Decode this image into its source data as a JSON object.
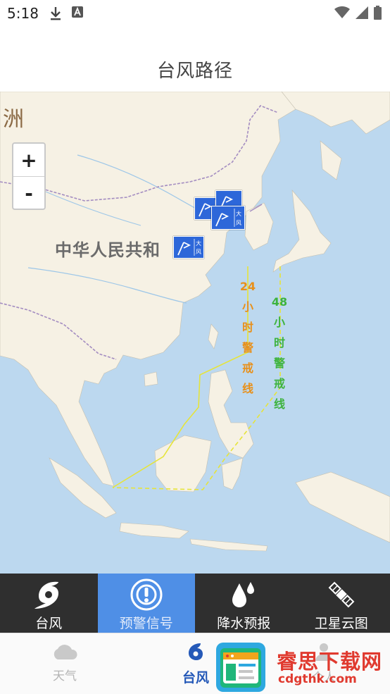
{
  "status_bar": {
    "time": "5:18",
    "icons": [
      "download-icon",
      "a-notification-icon",
      "wifi-icon",
      "signal-icon",
      "battery-icon"
    ]
  },
  "header": {
    "title": "台风路径"
  },
  "map": {
    "labels": {
      "continent_fragment": "洲",
      "country": "中华人民共和"
    },
    "zoom": {
      "in_label": "+",
      "out_label": "-"
    },
    "warning_lines": [
      {
        "text": "24小时警戒线",
        "chars": [
          "24",
          "小",
          "时",
          "警",
          "戒",
          "线"
        ],
        "color": "#e8901a"
      },
      {
        "text": "48小时警戒线",
        "chars": [
          "48",
          "小",
          "时",
          "警",
          "戒",
          "线"
        ],
        "color": "#3db33d"
      }
    ],
    "signal_icon_text": {
      "top": "大",
      "bottom": "风"
    }
  },
  "category_tabs": [
    {
      "label": "台风",
      "icon": "typhoon-icon",
      "active": false
    },
    {
      "label": "预警信号",
      "icon": "alert-signal-icon",
      "active": true
    },
    {
      "label": "降水预报",
      "icon": "raindrop-icon",
      "active": false
    },
    {
      "label": "卫星云图",
      "icon": "satellite-icon",
      "active": false
    }
  ],
  "bottom_nav": {
    "weather": {
      "label": "天气",
      "icon": "cloud-icon"
    },
    "typhoon": {
      "label": "台风",
      "icon": "typhoon-swirl-icon"
    },
    "me": {
      "label": "个人",
      "icon": "person-icon"
    }
  },
  "watermark": {
    "name": "睿思下载网",
    "url": "cdgthk.com"
  },
  "colors": {
    "sea": "#bcd8ef",
    "land": "#f6f1e4",
    "accent_tab": "#4f8fe6",
    "tab_bar": "#2f2f2f",
    "signal_blue": "#2d67d9",
    "nav_active": "#2559b8",
    "watermark_red": "#e03a2f"
  }
}
